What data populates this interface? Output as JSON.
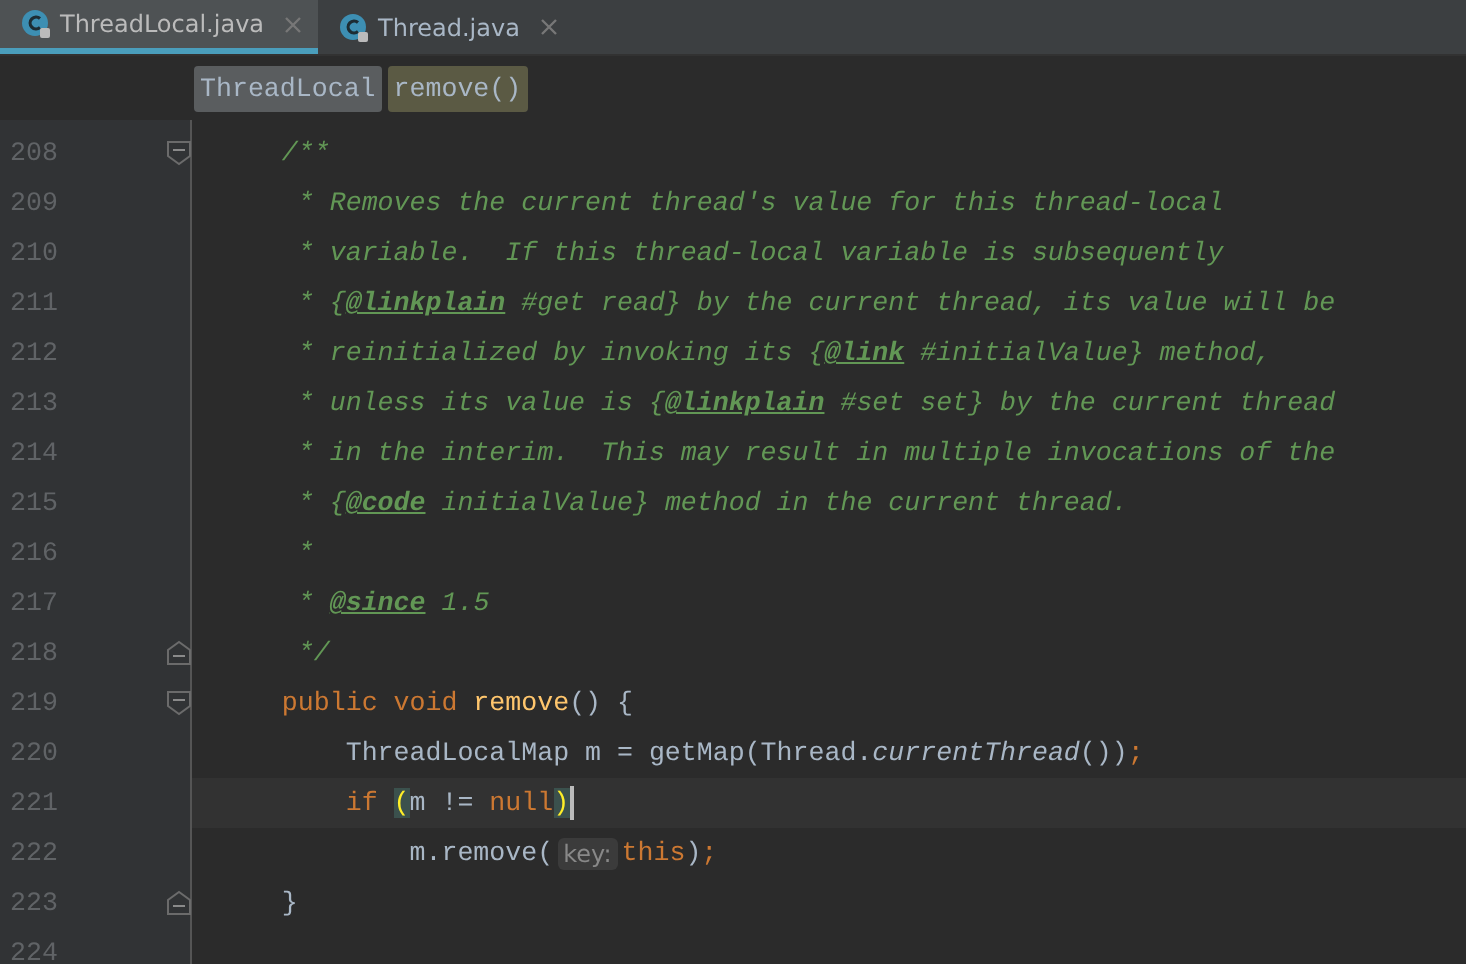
{
  "tabs": [
    {
      "label": "ThreadLocal.java",
      "selected": true
    },
    {
      "label": "Thread.java",
      "selected": false
    }
  ],
  "breadcrumbs": [
    {
      "label": "ThreadLocal",
      "kind": "class"
    },
    {
      "label": "remove()",
      "kind": "method"
    }
  ],
  "editor": {
    "lines": [
      {
        "number": "208",
        "kind": "fold_start",
        "current": false,
        "caret": false,
        "tokens": [
          {
            "kind": "comment",
            "text": "    /**"
          }
        ]
      },
      {
        "number": "209",
        "kind": "plain",
        "current": false,
        "caret": false,
        "tokens": [
          {
            "kind": "comment",
            "text": "     * Removes the current thread's value for this thread-local"
          }
        ]
      },
      {
        "number": "210",
        "kind": "plain",
        "current": false,
        "caret": false,
        "tokens": [
          {
            "kind": "comment",
            "text": "     * variable.  If this thread-local variable is subsequently"
          }
        ]
      },
      {
        "number": "211",
        "kind": "plain",
        "current": false,
        "caret": false,
        "tokens": [
          {
            "kind": "comment",
            "text": "     * {"
          },
          {
            "kind": "doctag",
            "text": "@linkplain"
          },
          {
            "kind": "comment",
            "text": " #get read} by the current thread, its value will be"
          }
        ]
      },
      {
        "number": "212",
        "kind": "plain",
        "current": false,
        "caret": false,
        "tokens": [
          {
            "kind": "comment",
            "text": "     * reinitialized by invoking its {"
          },
          {
            "kind": "doctag",
            "text": "@link"
          },
          {
            "kind": "comment",
            "text": " #initialValue} method,"
          }
        ]
      },
      {
        "number": "213",
        "kind": "plain",
        "current": false,
        "caret": false,
        "tokens": [
          {
            "kind": "comment",
            "text": "     * unless its value is {"
          },
          {
            "kind": "doctag",
            "text": "@linkplain"
          },
          {
            "kind": "comment",
            "text": " #set set} by the current thread"
          }
        ]
      },
      {
        "number": "214",
        "kind": "plain",
        "current": false,
        "caret": false,
        "tokens": [
          {
            "kind": "comment",
            "text": "     * in the interim.  This may result in multiple invocations of the"
          }
        ]
      },
      {
        "number": "215",
        "kind": "plain",
        "current": false,
        "caret": false,
        "tokens": [
          {
            "kind": "comment",
            "text": "     * {"
          },
          {
            "kind": "doctag",
            "text": "@code"
          },
          {
            "kind": "comment",
            "text": " initialValue} method in the current thread."
          }
        ]
      },
      {
        "number": "216",
        "kind": "plain",
        "current": false,
        "caret": false,
        "tokens": [
          {
            "kind": "comment",
            "text": "     *"
          }
        ]
      },
      {
        "number": "217",
        "kind": "plain",
        "current": false,
        "caret": false,
        "tokens": [
          {
            "kind": "comment",
            "text": "     * "
          },
          {
            "kind": "doctag",
            "text": "@since"
          },
          {
            "kind": "comment",
            "text": " 1.5"
          }
        ]
      },
      {
        "number": "218",
        "kind": "fold_end",
        "current": false,
        "caret": false,
        "tokens": [
          {
            "kind": "comment",
            "text": "     */"
          }
        ]
      },
      {
        "number": "219",
        "kind": "fold_start",
        "current": false,
        "caret": false,
        "tokens": [
          {
            "kind": "keyword",
            "text": "    public void "
          },
          {
            "kind": "method",
            "text": "remove"
          },
          {
            "kind": "plain",
            "text": "() {"
          }
        ]
      },
      {
        "number": "220",
        "kind": "plain",
        "current": false,
        "caret": false,
        "tokens": [
          {
            "kind": "plain",
            "text": "        ThreadLocalMap m = getMap(Thread."
          },
          {
            "kind": "static",
            "text": "currentThread"
          },
          {
            "kind": "plain",
            "text": "())"
          },
          {
            "kind": "keyword",
            "text": ";"
          }
        ]
      },
      {
        "number": "221",
        "kind": "plain",
        "current": true,
        "caret": true,
        "tokens": [
          {
            "kind": "keyword",
            "text": "        if "
          },
          {
            "kind": "brace",
            "text": "("
          },
          {
            "kind": "plain",
            "text": "m != "
          },
          {
            "kind": "keyword",
            "text": "null"
          },
          {
            "kind": "brace",
            "text": ")"
          }
        ]
      },
      {
        "number": "222",
        "kind": "plain",
        "current": false,
        "caret": false,
        "tokens": [
          {
            "kind": "plain",
            "text": "            m.remove("
          },
          {
            "kind": "hint",
            "text": "key:"
          },
          {
            "kind": "keyword",
            "text": "this"
          },
          {
            "kind": "plain",
            "text": ")"
          },
          {
            "kind": "keyword",
            "text": ";"
          }
        ]
      },
      {
        "number": "223",
        "kind": "fold_end",
        "current": false,
        "caret": false,
        "tokens": [
          {
            "kind": "plain",
            "text": "    }"
          }
        ]
      },
      {
        "number": "224",
        "kind": "plain",
        "current": false,
        "caret": false
      }
    ]
  }
}
